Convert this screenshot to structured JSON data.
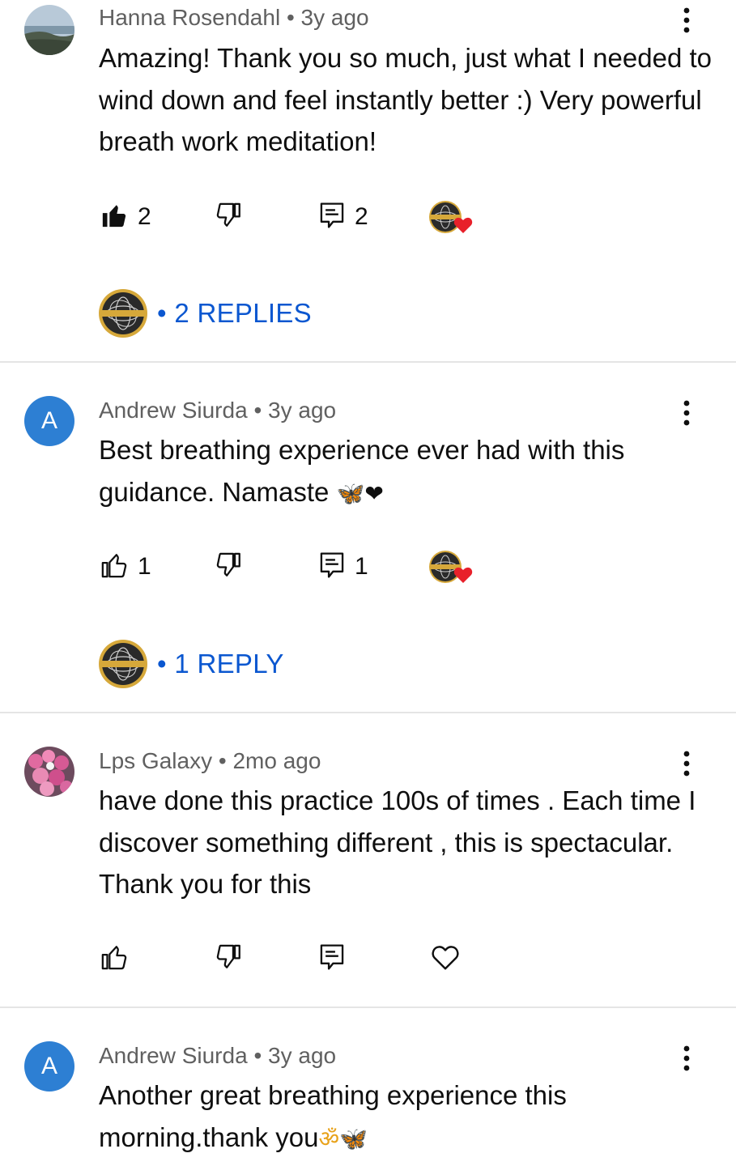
{
  "comments": [
    {
      "author": "Hanna Rosendahl",
      "age": "3y ago",
      "text": "Amazing! Thank you so much, just what I needed to wind down and feel instantly better :) Very powerful breath work meditation!",
      "likes": "2",
      "replies_count": "2",
      "liked": true,
      "replies_label": "2 REPLIES"
    },
    {
      "author": "Andrew Siurda",
      "age": "3y ago",
      "avatar_letter": "A",
      "text": "Best breathing experience ever had with this guidance. Namaste",
      "emoji": "🦋❤",
      "likes": "1",
      "replies_count": "1",
      "liked": false,
      "replies_label": "1 REPLY"
    },
    {
      "author": "Lps Galaxy",
      "age": "2mo ago",
      "text": "have done this practice 100s of times . Each time I discover something different , this is spectacular. Thank you for this",
      "likes": "",
      "replies_count": ""
    },
    {
      "author": "Andrew Siurda",
      "age": "3y ago",
      "avatar_letter": "A",
      "text": "Another great breathing experience this morning.thank you",
      "emoji": "ॐ🦋"
    }
  ],
  "separator": "•",
  "colors": {
    "link": "#0b57d0",
    "meta": "#606060",
    "avatar": "#2d7fd3",
    "heart": "#e8202a"
  },
  "icons": [
    "thumb-up-icon",
    "thumb-down-icon",
    "reply-icon",
    "heart-icon",
    "more-vert-icon",
    "creator-heart-badge"
  ]
}
